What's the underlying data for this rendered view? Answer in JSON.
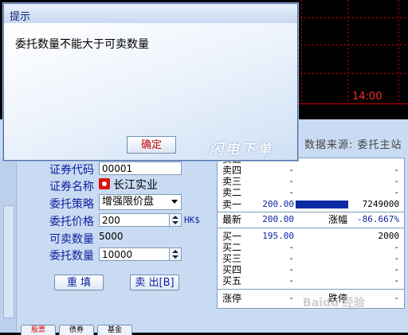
{
  "chart": {
    "time_label": "14:00"
  },
  "dialog": {
    "title": "提示",
    "message": "委托数量不能大于可卖数量",
    "ok_label": "确定"
  },
  "watermark": "闪电下单",
  "data_source": "数据来源:  委托主站",
  "form": {
    "code_label": "证券代码",
    "code_value": "00001",
    "name_label": "证券名称",
    "name_value": "长江实业",
    "strategy_label": "委托策略",
    "strategy_value": "增强限价盘",
    "price_label": "委托价格",
    "price_value": "200",
    "currency": "HK$",
    "sellable_label": "可卖数量",
    "sellable_value": "5000",
    "qty_label": "委托数量",
    "qty_value": "10000",
    "reset_label": "重 填",
    "sell_label": "卖 出[B]"
  },
  "quote": {
    "asks": [
      {
        "label": "卖五",
        "price": "",
        "vol": ""
      },
      {
        "label": "卖四",
        "price": "-",
        "vol": "-"
      },
      {
        "label": "卖三",
        "price": "-",
        "vol": "-"
      },
      {
        "label": "卖二",
        "price": "-",
        "vol": "-"
      },
      {
        "label": "卖一",
        "price": "200.00",
        "vol": "7249000"
      }
    ],
    "last_label": "最新",
    "last_price": "200.00",
    "change_label": "涨幅",
    "change_value": "-86.667%",
    "bids": [
      {
        "label": "买一",
        "price": "195.00",
        "vol": "2000"
      },
      {
        "label": "买二",
        "price": "-",
        "vol": "-"
      },
      {
        "label": "买三",
        "price": "-",
        "vol": "-"
      },
      {
        "label": "买四",
        "price": "-",
        "vol": "-"
      },
      {
        "label": "买五",
        "price": "-",
        "vol": "-"
      }
    ],
    "limit_up_label": "涨停",
    "limit_up_value": "-",
    "limit_down_label": "跌停",
    "limit_down_value": "-"
  },
  "bottom_tabs": [
    "股票",
    "债券",
    "基金"
  ],
  "site_watermark": "Baidu 经验"
}
